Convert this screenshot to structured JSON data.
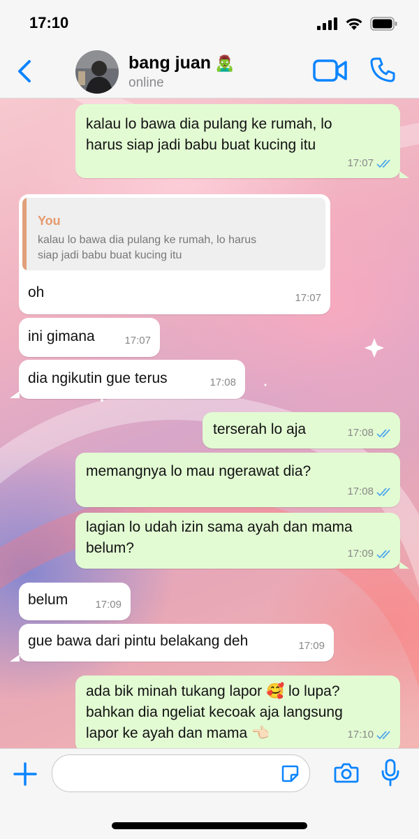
{
  "status_bar": {
    "time": "17:10"
  },
  "header": {
    "contact_name": "bang juan",
    "name_emoji": "🧟‍♂️",
    "status": "online"
  },
  "messages": [
    {
      "direction": "out",
      "text": "kalau lo bawa dia pulang ke rumah, lo\nharus siap jadi babu buat kucing itu",
      "time": "17:07",
      "read": true
    },
    {
      "direction": "in",
      "quote": {
        "sender": "You",
        "text": "kalau lo bawa dia pulang ke rumah, lo harus\nsiap jadi babu buat kucing itu"
      },
      "text": "oh",
      "time": "17:07"
    },
    {
      "direction": "in",
      "text": "ini gimana",
      "time": "17:07"
    },
    {
      "direction": "in",
      "text": "dia ngikutin gue terus",
      "time": "17:08"
    },
    {
      "direction": "out",
      "text": "terserah lo aja",
      "time": "17:08",
      "read": true
    },
    {
      "direction": "out",
      "text": "memangnya lo mau ngerawat dia?",
      "time": "17:08",
      "read": true
    },
    {
      "direction": "out",
      "text": "lagian lo udah izin sama ayah dan mama\nbelum?",
      "time": "17:09",
      "read": true
    },
    {
      "direction": "in",
      "text": "belum",
      "time": "17:09"
    },
    {
      "direction": "in",
      "text": "gue bawa dari pintu belakang deh",
      "time": "17:09"
    },
    {
      "direction": "out",
      "text": "ada bik minah tukang lapor 🥰 lo lupa?\nbahkan dia ngeliat kecoak aja langsung\nlapor ke ayah dan mama 👈🏻",
      "time": "17:10",
      "read": true
    }
  ],
  "input": {
    "placeholder": ""
  },
  "colors": {
    "accent": "#0a84ff",
    "outgoing_bubble": "#e2fbd3",
    "incoming_bubble": "#ffffff",
    "read_ticks": "#4fa8ec"
  }
}
